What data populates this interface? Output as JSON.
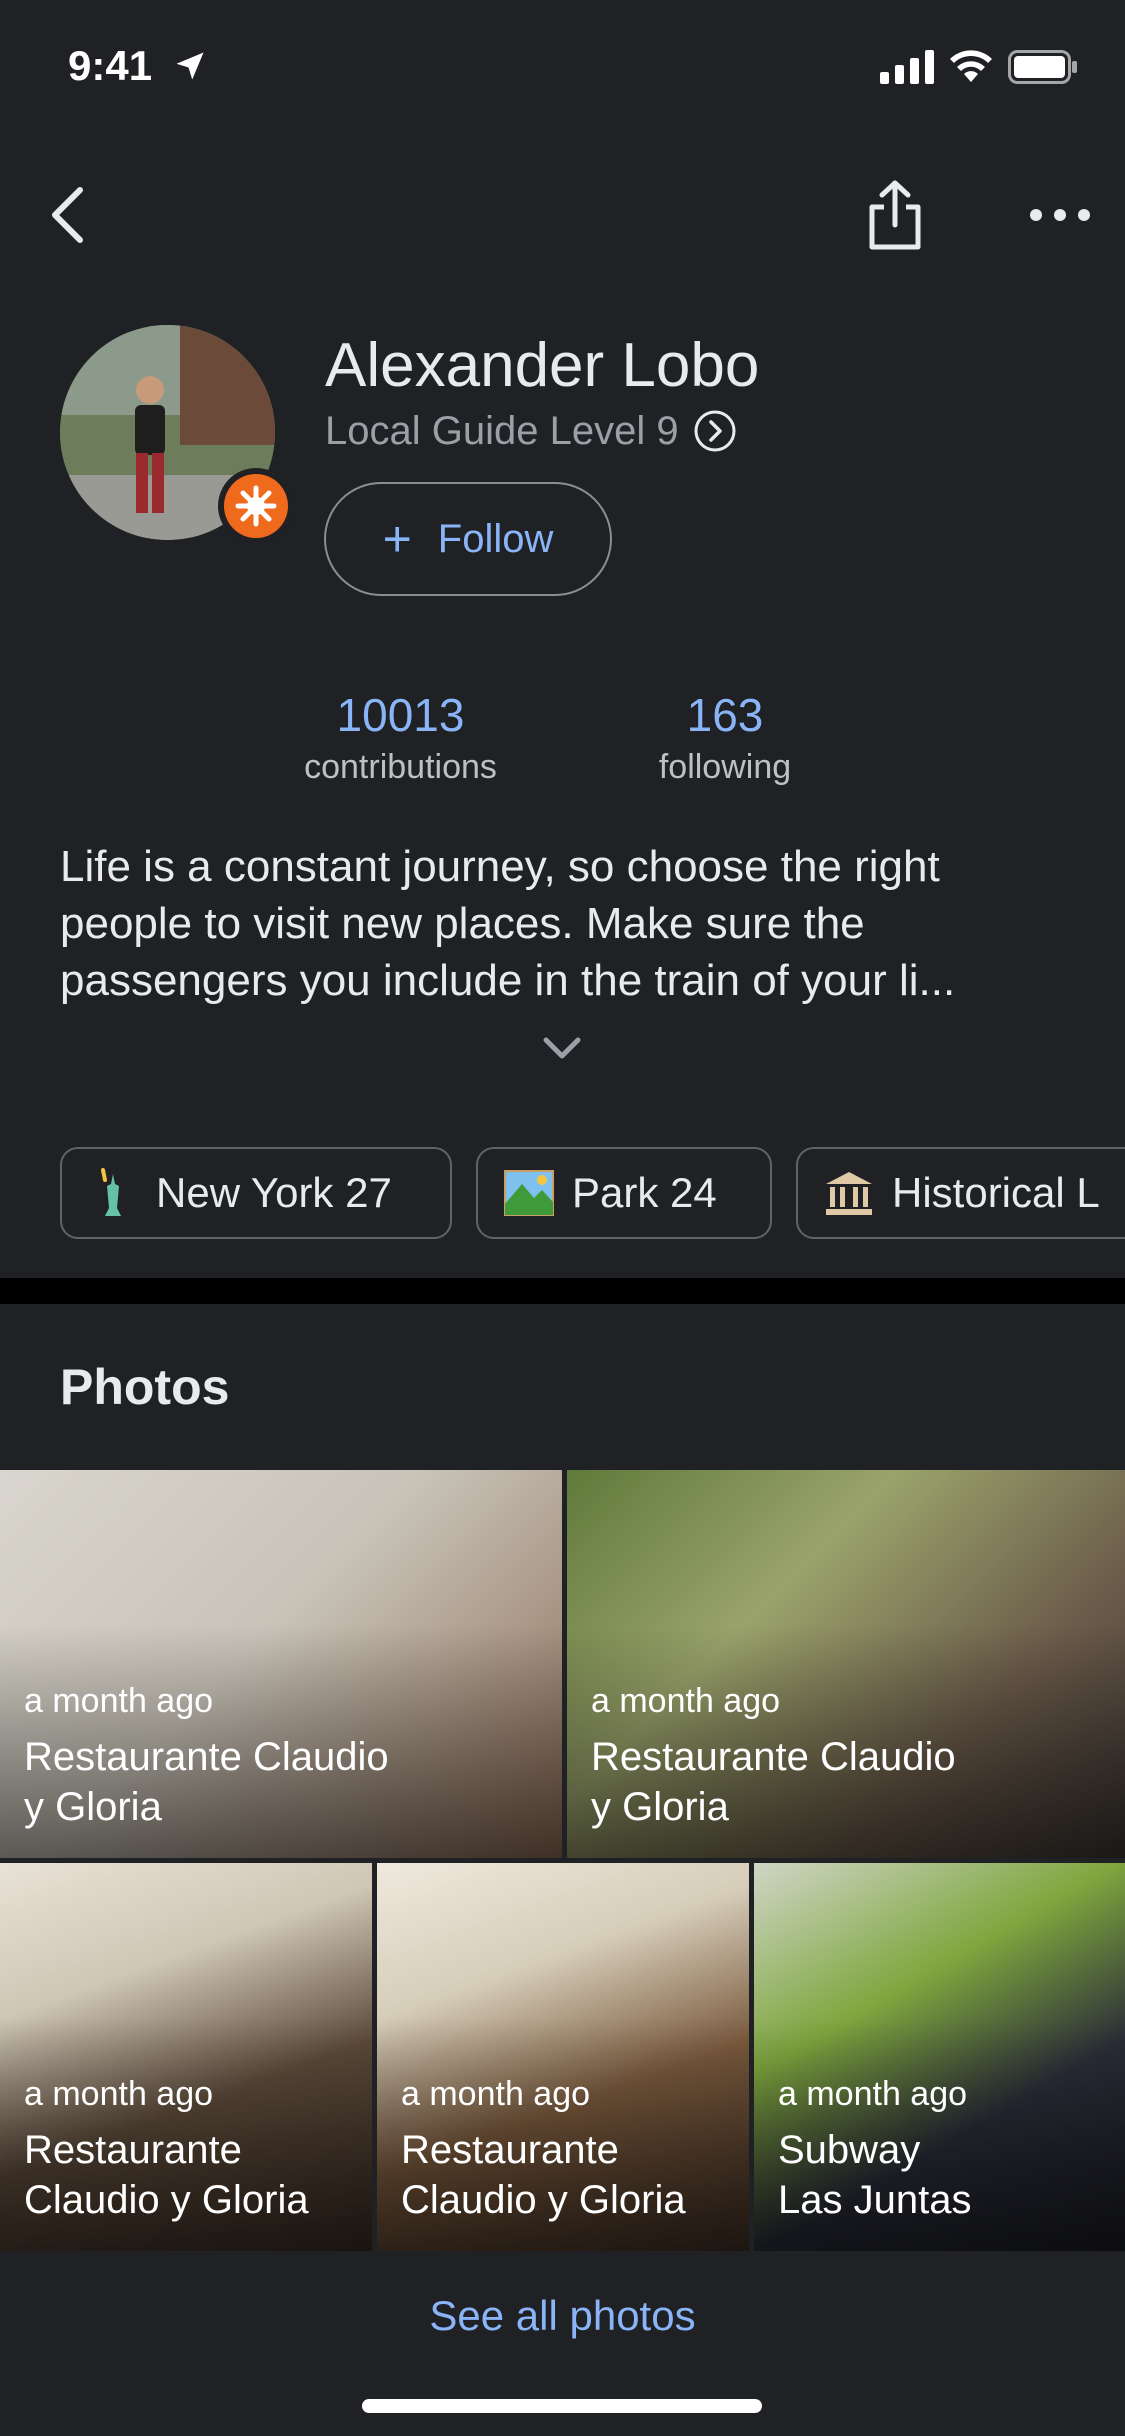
{
  "status_bar": {
    "time": "9:41"
  },
  "profile": {
    "name": "Alexander Lobo",
    "level": "Local Guide Level 9",
    "follow_label": "Follow",
    "follow_icon": "+"
  },
  "stats": [
    {
      "value": "10013",
      "label": "contributions"
    },
    {
      "value": "163",
      "label": "following"
    }
  ],
  "bio": "Life is a constant journey, so choose the right people to visit new places. Make sure the passengers you include in the train of your li...",
  "chips": [
    {
      "icon": "statue-of-liberty-icon",
      "label": "New York 27"
    },
    {
      "icon": "park-icon",
      "label": "Park 24"
    },
    {
      "icon": "classical-building-icon",
      "label": "Historical L"
    }
  ],
  "photos": {
    "title": "Photos",
    "items": [
      {
        "time": "a month ago",
        "title": "Restaurante Claudio\ny Gloria"
      },
      {
        "time": "a month ago",
        "title": "Restaurante Claudio\ny Gloria"
      },
      {
        "time": "a month ago",
        "title": "Restaurante\nClaudio y Gloria"
      },
      {
        "time": "a month ago",
        "title": "Restaurante\nClaudio y Gloria"
      },
      {
        "time": "a month ago",
        "title": "Subway\nLas Juntas"
      }
    ],
    "see_all": "See all photos"
  },
  "colors": {
    "background": "#202124",
    "accent": "#8ab4f8",
    "badge": "#f06a1d"
  }
}
